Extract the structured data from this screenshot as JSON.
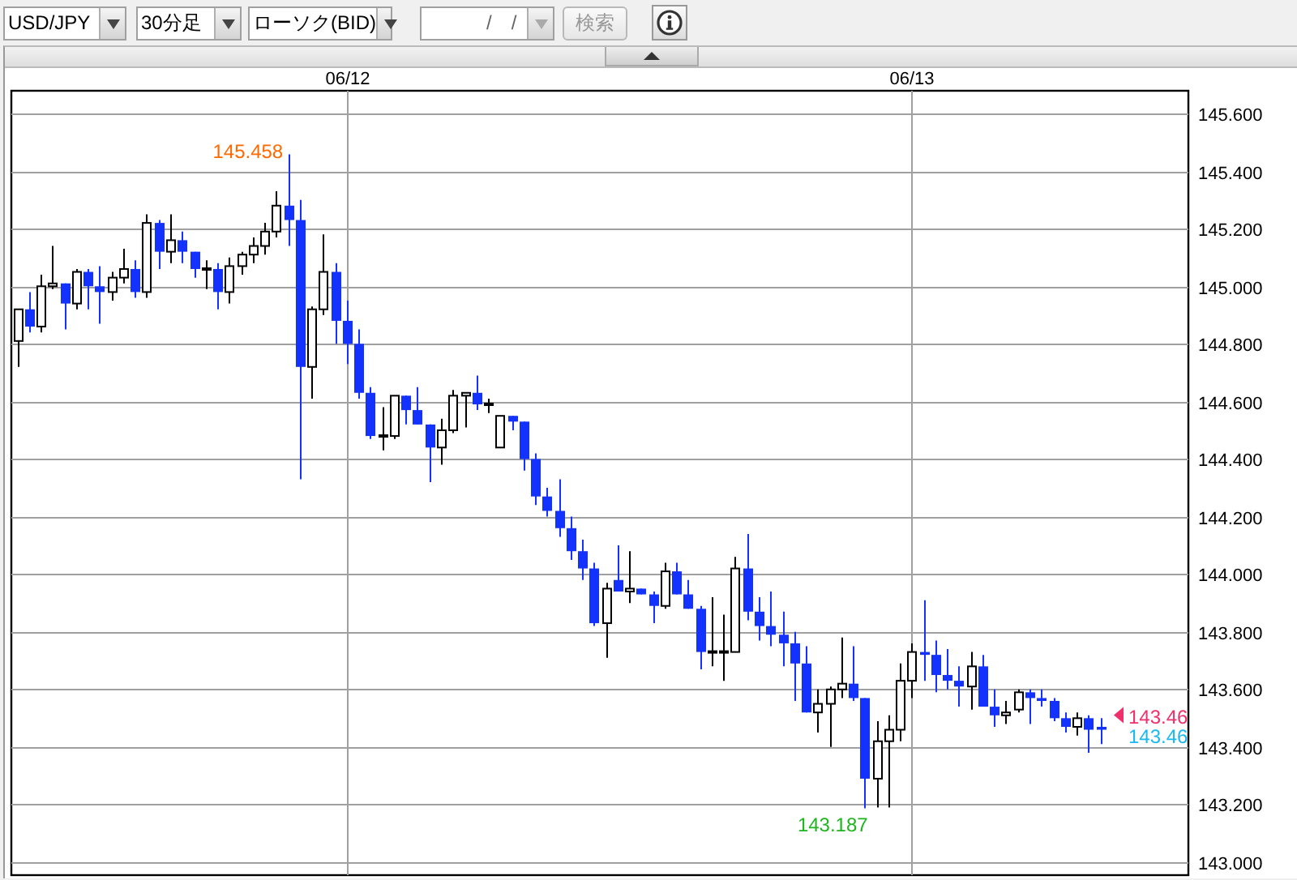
{
  "toolbar": {
    "currency_pair": {
      "value": "USD/JPY"
    },
    "timeframe": {
      "value": "30分足"
    },
    "chart_type": {
      "value": "ローソク(BID)"
    },
    "date_field": {
      "value": "/　/",
      "disabled": true
    },
    "search_button": {
      "label": "検索",
      "disabled": true
    }
  },
  "chart": {
    "collapse_button": {
      "expanded": true
    },
    "chart_data": {
      "type": "candlestick",
      "grid": true,
      "ylim": [
        142.955,
        145.679
      ],
      "yticks": [
        {
          "value": 145.6,
          "label": "145.600"
        },
        {
          "value": 145.4,
          "label": "145.400"
        },
        {
          "value": 145.2,
          "label": "145.200"
        },
        {
          "value": 145.0,
          "label": "145.000"
        },
        {
          "value": 144.8,
          "label": "144.800"
        },
        {
          "value": 144.6,
          "label": "144.600"
        },
        {
          "value": 144.4,
          "label": "144.400"
        },
        {
          "value": 144.2,
          "label": "144.200"
        },
        {
          "value": 144.0,
          "label": "144.000"
        },
        {
          "value": 143.8,
          "label": "143.800"
        },
        {
          "value": 143.6,
          "label": "143.600"
        },
        {
          "value": 143.4,
          "label": "143.400"
        },
        {
          "value": 143.2,
          "label": "143.200"
        },
        {
          "value": 143.0,
          "label": "143.000"
        }
      ],
      "categories": [
        null,
        null,
        null,
        null,
        null,
        null,
        null,
        null,
        null,
        null,
        null,
        null,
        null,
        null,
        null,
        null,
        null,
        null,
        null,
        null,
        null,
        null,
        null,
        null,
        null,
        null,
        null,
        null,
        "06/12",
        null,
        null,
        null,
        null,
        null,
        null,
        null,
        null,
        null,
        null,
        null,
        null,
        null,
        null,
        null,
        null,
        null,
        null,
        null,
        null,
        null,
        null,
        null,
        null,
        null,
        null,
        null,
        null,
        null,
        null,
        null,
        null,
        null,
        null,
        null,
        null,
        null,
        null,
        null,
        null,
        null,
        null,
        null,
        null,
        null,
        null,
        null,
        "06/13",
        null,
        null,
        null,
        null,
        null,
        null,
        null,
        null,
        null,
        null,
        null,
        null,
        null,
        null,
        null,
        null,
        null,
        null,
        null,
        null,
        null,
        null,
        null
      ],
      "ohlc": [
        [
          144.81,
          144.92,
          144.72,
          144.92
        ],
        [
          144.92,
          144.98,
          144.84,
          144.86
        ],
        [
          144.86,
          145.04,
          144.84,
          145.0
        ],
        [
          145.0,
          145.14,
          144.99,
          145.01
        ],
        [
          145.01,
          145.01,
          144.85,
          144.94
        ],
        [
          144.94,
          145.06,
          144.92,
          145.05
        ],
        [
          145.05,
          145.06,
          144.92,
          145.0
        ],
        [
          145.0,
          145.07,
          144.87,
          144.98
        ],
        [
          144.98,
          145.05,
          144.95,
          145.03
        ],
        [
          145.03,
          145.13,
          145.01,
          145.06
        ],
        [
          145.06,
          145.09,
          144.96,
          144.98
        ],
        [
          144.98,
          145.25,
          144.96,
          145.22
        ],
        [
          145.22,
          145.23,
          145.06,
          145.12
        ],
        [
          145.12,
          145.25,
          145.08,
          145.16
        ],
        [
          145.16,
          145.19,
          145.08,
          145.12
        ],
        [
          145.12,
          145.12,
          145.03,
          145.06
        ],
        [
          145.06,
          145.09,
          144.99,
          145.06
        ],
        [
          145.06,
          145.08,
          144.92,
          144.98
        ],
        [
          144.98,
          145.1,
          144.94,
          145.07
        ],
        [
          145.07,
          145.12,
          145.04,
          145.11
        ],
        [
          145.11,
          145.17,
          145.08,
          145.14
        ],
        [
          145.14,
          145.22,
          145.11,
          145.19
        ],
        [
          145.19,
          145.33,
          145.17,
          145.28
        ],
        [
          145.28,
          145.458,
          145.14,
          145.23
        ],
        [
          145.23,
          145.3,
          144.33,
          144.72
        ],
        [
          144.72,
          144.93,
          144.61,
          144.92
        ],
        [
          144.92,
          145.18,
          144.9,
          145.05
        ],
        [
          145.05,
          145.08,
          144.8,
          144.88
        ],
        [
          144.88,
          144.95,
          144.73,
          144.8
        ],
        [
          144.8,
          144.85,
          144.61,
          144.63
        ],
        [
          144.63,
          144.65,
          144.47,
          144.48
        ],
        [
          144.48,
          144.58,
          144.43,
          144.48
        ],
        [
          144.48,
          144.62,
          144.47,
          144.62
        ],
        [
          144.62,
          144.62,
          144.52,
          144.57
        ],
        [
          144.57,
          144.65,
          144.52,
          144.52
        ],
        [
          144.52,
          144.52,
          144.32,
          144.44
        ],
        [
          144.44,
          144.54,
          144.38,
          144.5
        ],
        [
          144.5,
          144.64,
          144.49,
          144.62
        ],
        [
          144.62,
          144.63,
          144.51,
          144.63
        ],
        [
          144.63,
          144.69,
          144.57,
          144.59
        ],
        [
          144.59,
          144.61,
          144.56,
          144.59
        ],
        [
          144.44,
          144.55,
          144.44,
          144.55
        ],
        [
          144.55,
          144.55,
          144.5,
          144.53
        ],
        [
          144.53,
          144.53,
          144.36,
          144.4
        ],
        [
          144.4,
          144.42,
          144.24,
          144.27
        ],
        [
          144.27,
          144.3,
          144.2,
          144.22
        ],
        [
          144.22,
          144.33,
          144.13,
          144.16
        ],
        [
          144.16,
          144.2,
          144.05,
          144.08
        ],
        [
          144.08,
          144.12,
          143.98,
          144.02
        ],
        [
          144.02,
          144.04,
          143.82,
          143.83
        ],
        [
          143.83,
          143.97,
          143.71,
          143.95
        ],
        [
          143.98,
          144.1,
          143.94,
          143.94
        ],
        [
          143.94,
          144.08,
          143.9,
          143.95
        ],
        [
          143.95,
          143.95,
          143.93,
          143.93
        ],
        [
          143.93,
          143.94,
          143.83,
          143.89
        ],
        [
          143.89,
          144.04,
          143.88,
          144.01
        ],
        [
          144.01,
          144.04,
          143.93,
          143.93
        ],
        [
          143.93,
          143.98,
          143.88,
          143.88
        ],
        [
          143.88,
          143.89,
          143.67,
          143.73
        ],
        [
          143.73,
          143.92,
          143.68,
          143.73
        ],
        [
          143.73,
          143.86,
          143.63,
          143.73
        ],
        [
          143.73,
          144.06,
          143.73,
          144.02
        ],
        [
          144.02,
          144.14,
          143.84,
          143.87
        ],
        [
          143.87,
          143.92,
          143.77,
          143.82
        ],
        [
          143.82,
          143.94,
          143.75,
          143.79
        ],
        [
          143.79,
          143.87,
          143.68,
          143.76
        ],
        [
          143.76,
          143.8,
          143.56,
          143.69
        ],
        [
          143.69,
          143.75,
          143.52,
          143.52
        ],
        [
          143.52,
          143.6,
          143.45,
          143.55
        ],
        [
          143.55,
          143.61,
          143.4,
          143.6
        ],
        [
          143.6,
          143.78,
          143.57,
          143.62
        ],
        [
          143.62,
          143.75,
          143.56,
          143.57
        ],
        [
          143.57,
          143.57,
          143.187,
          143.29
        ],
        [
          143.29,
          143.49,
          143.19,
          143.42
        ],
        [
          143.42,
          143.51,
          143.19,
          143.46
        ],
        [
          143.46,
          143.69,
          143.42,
          143.63
        ],
        [
          143.63,
          143.76,
          143.57,
          143.73
        ],
        [
          143.73,
          143.91,
          143.63,
          143.72
        ],
        [
          143.72,
          143.77,
          143.59,
          143.65
        ],
        [
          143.65,
          143.74,
          143.6,
          143.63
        ],
        [
          143.63,
          143.68,
          143.54,
          143.61
        ],
        [
          143.61,
          143.73,
          143.53,
          143.68
        ],
        [
          143.68,
          143.72,
          143.54,
          143.54
        ],
        [
          143.54,
          143.6,
          143.47,
          143.51
        ],
        [
          143.51,
          143.56,
          143.48,
          143.52
        ],
        [
          143.53,
          143.6,
          143.52,
          143.59
        ],
        [
          143.59,
          143.6,
          143.48,
          143.57
        ],
        [
          143.57,
          143.6,
          143.54,
          143.56
        ],
        [
          143.56,
          143.57,
          143.49,
          143.5
        ],
        [
          143.5,
          143.52,
          143.45,
          143.47
        ],
        [
          143.47,
          143.52,
          143.44,
          143.5
        ],
        [
          143.5,
          143.51,
          143.38,
          143.46
        ],
        [
          143.47,
          143.5,
          143.41,
          143.46
        ],
        null,
        null,
        null,
        null,
        null,
        null,
        null
      ],
      "annotations": [
        "145.458",
        "143.187"
      ]
    },
    "current_prices": [
      {
        "text": "143.46",
        "color": "#f0306a",
        "pointer": true
      },
      {
        "text": "143.46",
        "color": "#1ab8f0",
        "pointer": false
      }
    ]
  }
}
